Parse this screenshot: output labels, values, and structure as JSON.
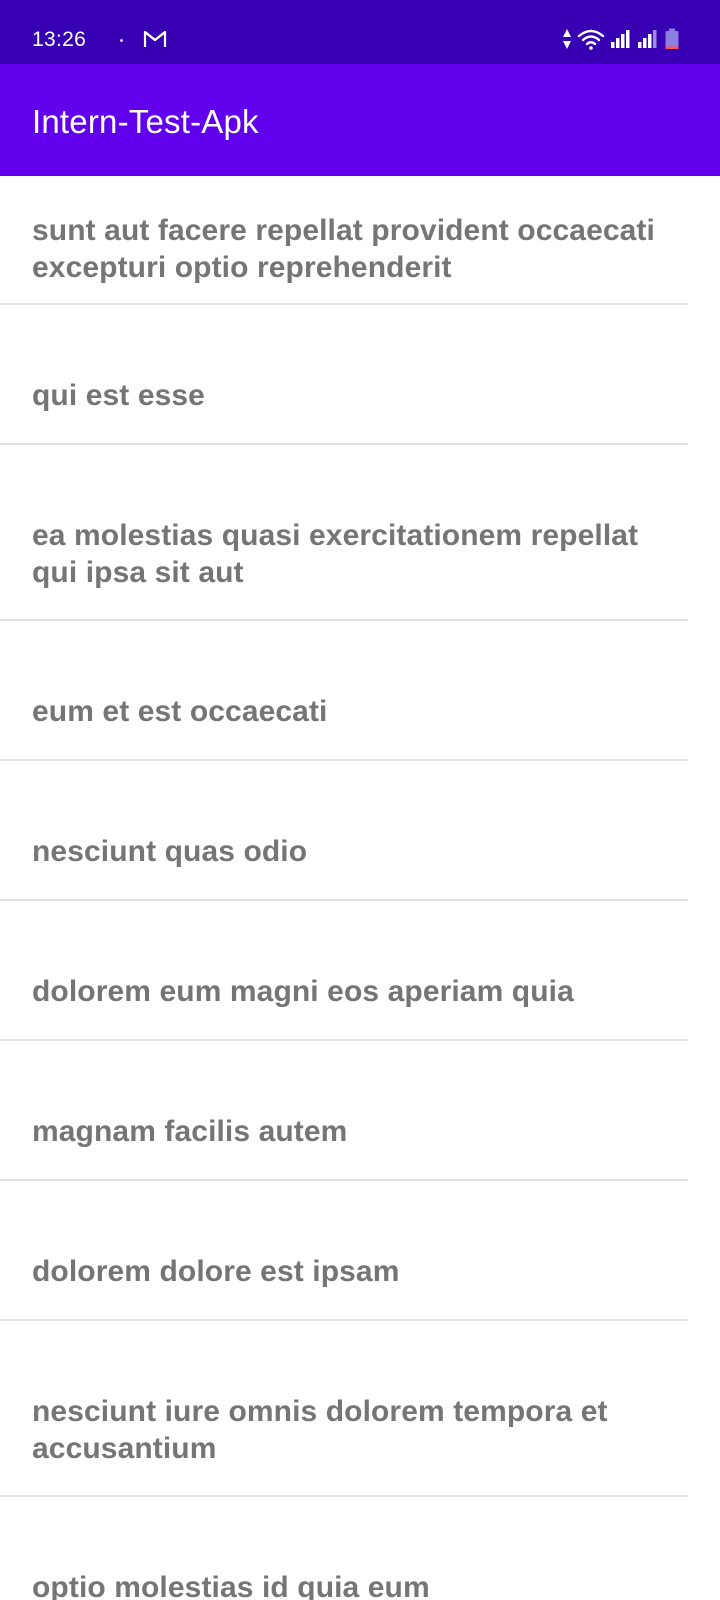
{
  "status_bar": {
    "time": "13:26",
    "notification_icons": [
      "gmail-icon"
    ],
    "system_icons": [
      "data-arrows-icon",
      "wifi-icon",
      "signal-icon",
      "signal-icon",
      "battery-icon"
    ],
    "background_color": "#3700b3"
  },
  "app_bar": {
    "title": "Intern-Test-Apk",
    "background_color": "#6200ee",
    "title_color": "#ffffff"
  },
  "posts": [
    {
      "title": "sunt aut facere repellat provident occaecati excepturi optio reprehenderit"
    },
    {
      "title": "qui est esse"
    },
    {
      "title": "ea molestias quasi exercitationem repellat qui ipsa sit aut"
    },
    {
      "title": "eum et est occaecati"
    },
    {
      "title": "nesciunt quas odio"
    },
    {
      "title": "dolorem eum magni eos aperiam quia"
    },
    {
      "title": "magnam facilis autem"
    },
    {
      "title": "dolorem dolore est ipsam"
    },
    {
      "title": "nesciunt iure omnis dolorem tempora et accusantium"
    },
    {
      "title": "optio molestias id quia eum"
    }
  ],
  "list_style": {
    "text_color": "#757575",
    "divider_color": "#e4e4e4"
  }
}
